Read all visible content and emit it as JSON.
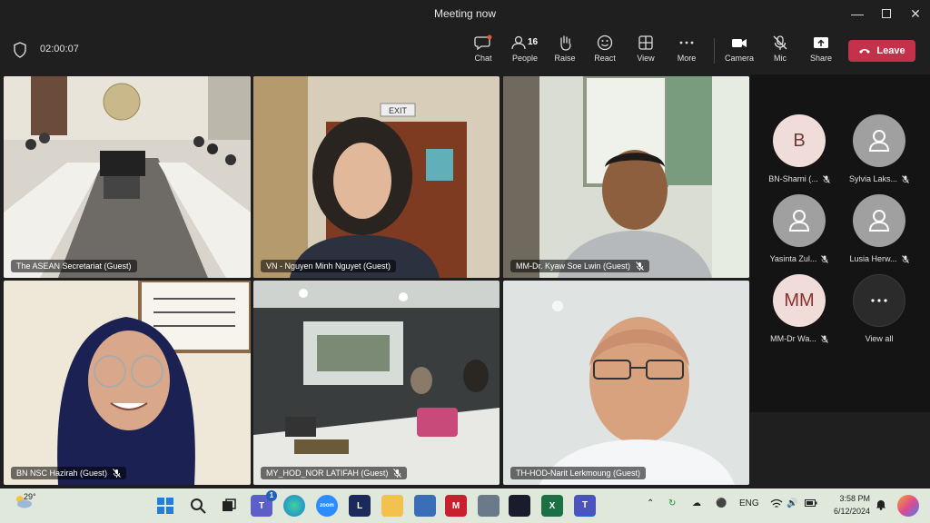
{
  "window": {
    "title": "Meeting now"
  },
  "toolbar": {
    "timer": "02:00:07",
    "buttons": [
      {
        "label": "Chat",
        "icon": "chat-icon"
      },
      {
        "label": "People",
        "icon": "people-icon",
        "count": "16"
      },
      {
        "label": "Raise",
        "icon": "raise-hand-icon"
      },
      {
        "label": "React",
        "icon": "react-icon"
      },
      {
        "label": "View",
        "icon": "view-icon"
      },
      {
        "label": "More",
        "icon": "more-icon"
      },
      {
        "label": "Camera",
        "icon": "camera-icon"
      },
      {
        "label": "Mic",
        "icon": "mic-off-icon"
      },
      {
        "label": "Share",
        "icon": "share-icon"
      }
    ],
    "leave_label": "Leave",
    "leave_color": "#c4314b"
  },
  "tiles": [
    {
      "name": "The ASEAN Secretariat (Guest)",
      "muted": false
    },
    {
      "name": "VN - Nguyen Minh Nguyet (Guest)",
      "muted": false
    },
    {
      "name": "MM-Dr. Kyaw Soe Lwin (Guest)",
      "muted": true
    },
    {
      "name": "BN NSC Hazirah (Guest)",
      "muted": true
    },
    {
      "name": "MY_HOD_NOR LATIFAH (Guest)",
      "muted": true
    },
    {
      "name": "TH-HOD-Narit Lerkmoung (Guest)",
      "muted": false
    }
  ],
  "participants": [
    {
      "initials": "B",
      "name": "BN-Sharni (...",
      "muted": true,
      "avatar_bg": "#f0dcd8",
      "avatar_fg": "#6b3a32"
    },
    {
      "initials": "",
      "name": "Sylvia Laks...",
      "muted": true,
      "avatar_bg": "#a0a0a0"
    },
    {
      "initials": "",
      "name": "Yasinta Zul...",
      "muted": true,
      "avatar_bg": "#a0a0a0"
    },
    {
      "initials": "",
      "name": "Lusia Herw...",
      "muted": true,
      "avatar_bg": "#a0a0a0"
    },
    {
      "initials": "MM",
      "name": "MM-Dr Wa...",
      "muted": true,
      "avatar_bg": "#f0dcd8",
      "avatar_fg": "#8a2f2f"
    },
    {
      "initials": "",
      "name": "View all",
      "muted": false,
      "avatar_bg": "#2b2b2b"
    }
  ],
  "taskbar": {
    "weather": "29°",
    "teams_badge": "1",
    "language": "ENG",
    "time": "3:58 PM",
    "date": "6/12/2024"
  }
}
